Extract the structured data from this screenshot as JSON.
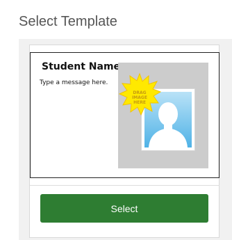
{
  "header": {
    "title": "Select Template"
  },
  "template": {
    "student_name": "Student Name",
    "message": "Type a message here.",
    "drag_badge": {
      "line1": "DRAG",
      "line2": "IMAGE",
      "line3": "HERE"
    },
    "icons": {
      "badge": "starburst-icon",
      "photo": "person-silhouette-icon"
    }
  },
  "actions": {
    "select_label": "Select"
  },
  "colors": {
    "button": "#2e7d32",
    "badge": "#ffe900",
    "badge_text": "#c59b10",
    "photo_sky": "#74c3ec",
    "placeholder": "#cccccc"
  }
}
